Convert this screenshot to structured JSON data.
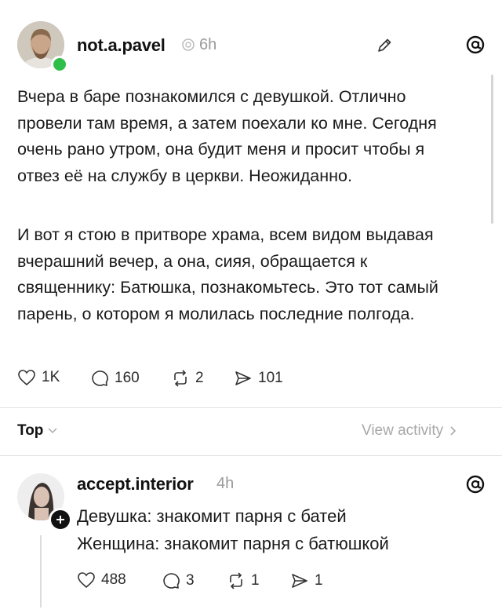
{
  "post": {
    "username": "not.a.pavel",
    "time": "6h",
    "paragraph1": "Вчера в баре познакомился с девушкой. Отлично провели там время, а затем поехали ко мне. Сегодня очень рано утром, она будит меня и просит чтобы я отвез её на службу в церкви. Неожиданно.",
    "paragraph2": "И вот я стою в притворе храма, всем видом выдавая вчерашний вечер, а она, сияя, обращается к священнику: Батюшка, познакомьтесь. Это тот самый парень, о котором я молилась последние полгода.",
    "stats": {
      "likes": "1K",
      "comments": "160",
      "reposts": "2",
      "shares": "101"
    }
  },
  "sort": {
    "label": "Top",
    "activity_link": "View activity"
  },
  "reply": {
    "username": "accept.interior",
    "time": "4h",
    "line1": "Девушка: знакомит парня с батей",
    "line2": "Женщина: знакомит парня с батюшкой",
    "stats": {
      "likes": "488",
      "comments": "3",
      "reposts": "1",
      "shares": "1"
    }
  },
  "colors": {
    "online": "#2fbf48",
    "muted": "#9a9a9a",
    "text": "#1b1b1b"
  },
  "icons": [
    "heart-icon",
    "comment-icon",
    "repost-icon",
    "share-icon",
    "edit-icon",
    "threads-logo-icon",
    "add-icon",
    "verified-icon"
  ]
}
